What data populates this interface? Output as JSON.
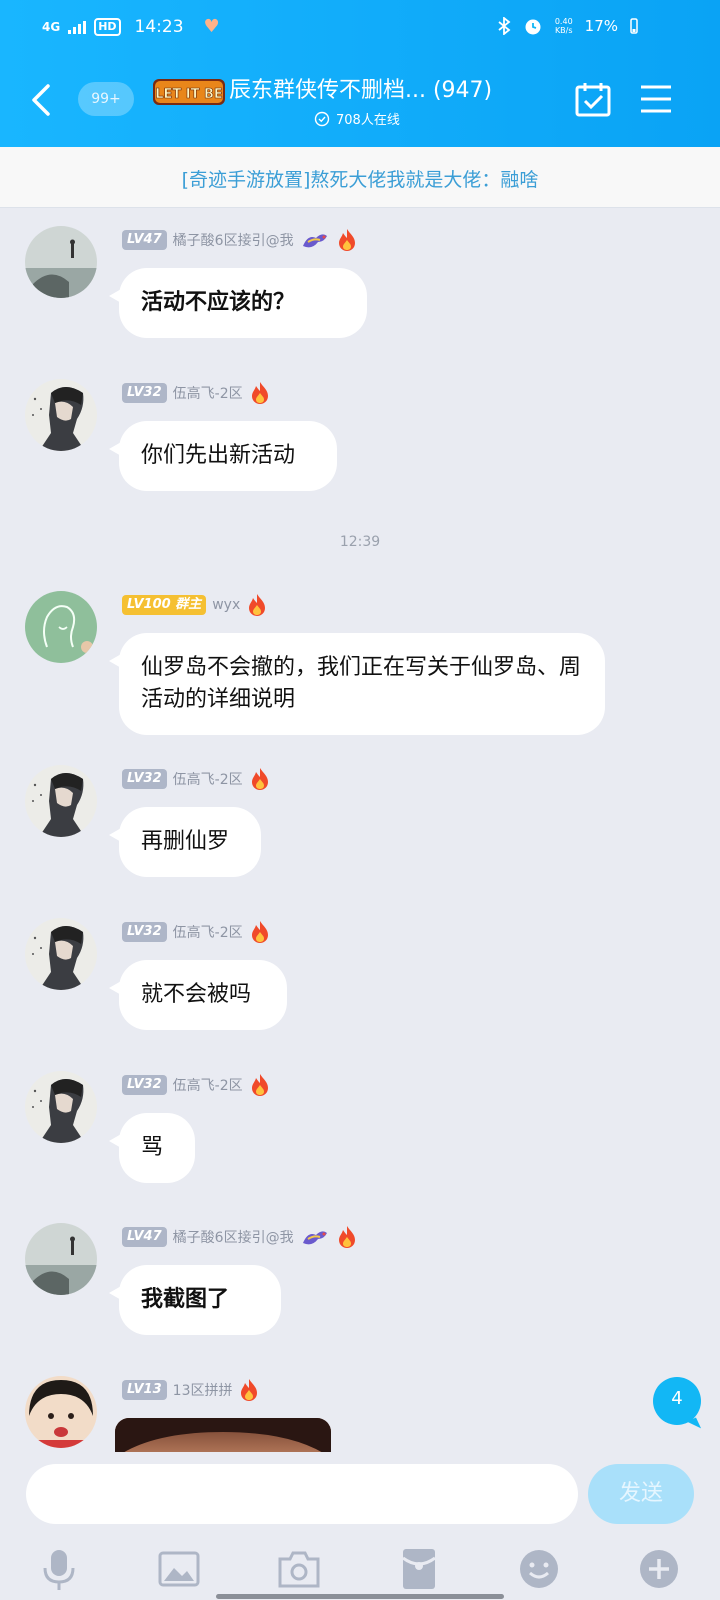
{
  "status_bar": {
    "network": "4G",
    "hd": "HD",
    "time": "14:23",
    "speed_value": "0.40",
    "speed_unit": "KB/s",
    "battery": "17%"
  },
  "header": {
    "unread_count": "99+",
    "logo_text": "LET IT BE",
    "title": "辰东群侠传不删档... (947)",
    "online": "708人在线"
  },
  "announcement": "[奇迹手游放置]熬死大佬我就是大佬：融啥",
  "time_separator": "12:39",
  "messages": [
    {
      "level": "LV47",
      "nick": "橘子酸6区接引@我",
      "text": "活动不应该的？"
    },
    {
      "level": "LV32",
      "nick": "伍高飞-2区",
      "text": "你们先出新活动"
    },
    {
      "level": "LV100 群主",
      "nick": "wyx",
      "text": "仙罗岛不会撤的，我们正在写关于仙罗岛、周活动的详细说明"
    },
    {
      "level": "LV32",
      "nick": "伍高飞-2区",
      "text": "再删仙罗"
    },
    {
      "level": "LV32",
      "nick": "伍高飞-2区",
      "text": "就不会被吗"
    },
    {
      "level": "LV32",
      "nick": "伍高飞-2区",
      "text": "骂"
    },
    {
      "level": "LV47",
      "nick": "橘子酸6区接引@我",
      "text": "我截图了"
    },
    {
      "level": "LV13",
      "nick": "13区拼拼"
    }
  ],
  "unread_badge": "4",
  "composer": {
    "placeholder": "",
    "send_label": "发送"
  },
  "colors": {
    "header": "#12b7f5",
    "owner_badge": "#f5c032",
    "level_badge": "#aeb6c8",
    "chat_bg": "#e9ebf2"
  },
  "toolbar_icons": [
    "microphone-icon",
    "image-icon",
    "camera-icon",
    "red-packet-icon",
    "emoji-icon",
    "plus-icon"
  ]
}
